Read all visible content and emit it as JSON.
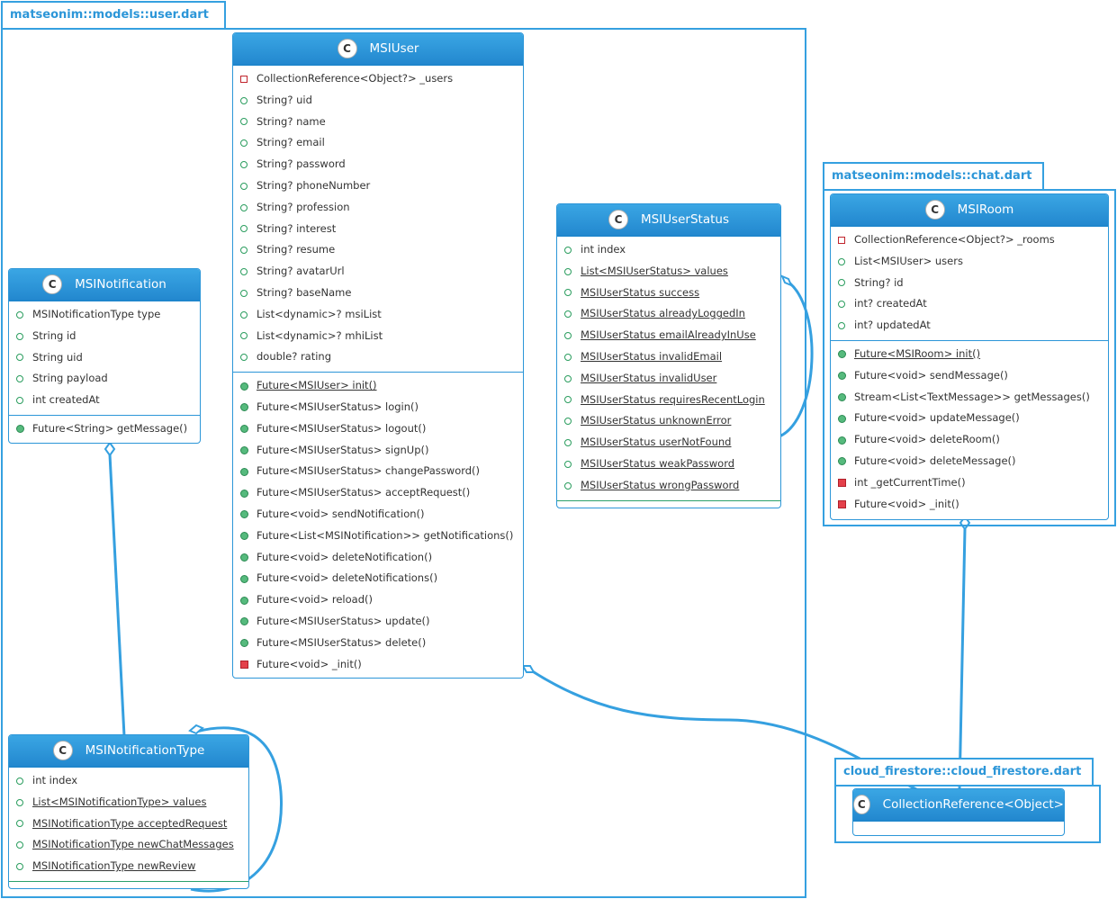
{
  "packages": {
    "user": "matseonim::models::user.dart",
    "chat": "matseonim::models::chat.dart",
    "firestore": "cloud_firestore::cloud_firestore.dart"
  },
  "stereotype": "C",
  "classes": {
    "msiuser": {
      "name": "MSIUser",
      "fields": [
        {
          "vis": "private",
          "text": "CollectionReference<Object?> _users"
        },
        {
          "vis": "public",
          "text": "String? uid"
        },
        {
          "vis": "public",
          "text": "String? name"
        },
        {
          "vis": "public",
          "text": "String? email"
        },
        {
          "vis": "public",
          "text": "String? password"
        },
        {
          "vis": "public",
          "text": "String? phoneNumber"
        },
        {
          "vis": "public",
          "text": "String? profession"
        },
        {
          "vis": "public",
          "text": "String? interest"
        },
        {
          "vis": "public",
          "text": "String? resume"
        },
        {
          "vis": "public",
          "text": "String? avatarUrl"
        },
        {
          "vis": "public",
          "text": "String? baseName"
        },
        {
          "vis": "public",
          "text": "List<dynamic>? msiList"
        },
        {
          "vis": "public",
          "text": "List<dynamic>? mhiList"
        },
        {
          "vis": "public",
          "text": "double? rating"
        }
      ],
      "methods": [
        {
          "vis": "public",
          "text": "Future<MSIUser> init()",
          "static": true
        },
        {
          "vis": "public",
          "text": "Future<MSIUserStatus> login()"
        },
        {
          "vis": "public",
          "text": "Future<MSIUserStatus> logout()"
        },
        {
          "vis": "public",
          "text": "Future<MSIUserStatus> signUp()"
        },
        {
          "vis": "public",
          "text": "Future<MSIUserStatus> changePassword()"
        },
        {
          "vis": "public",
          "text": "Future<MSIUserStatus> acceptRequest()"
        },
        {
          "vis": "public",
          "text": "Future<void> sendNotification()"
        },
        {
          "vis": "public",
          "text": "Future<List<MSINotification>> getNotifications()"
        },
        {
          "vis": "public",
          "text": "Future<void> deleteNotification()"
        },
        {
          "vis": "public",
          "text": "Future<void> deleteNotifications()"
        },
        {
          "vis": "public",
          "text": "Future<void> reload()"
        },
        {
          "vis": "public",
          "text": "Future<MSIUserStatus> update()"
        },
        {
          "vis": "public",
          "text": "Future<MSIUserStatus> delete()"
        },
        {
          "vis": "private",
          "text": "Future<void> _init()"
        }
      ]
    },
    "msiuserstatus": {
      "name": "MSIUserStatus",
      "fields": [
        {
          "vis": "public",
          "text": "int index"
        },
        {
          "vis": "public",
          "text": "List<MSIUserStatus> values",
          "static": true
        },
        {
          "vis": "public",
          "text": "MSIUserStatus success",
          "static": true
        },
        {
          "vis": "public",
          "text": "MSIUserStatus alreadyLoggedIn",
          "static": true
        },
        {
          "vis": "public",
          "text": "MSIUserStatus emailAlreadyInUse",
          "static": true
        },
        {
          "vis": "public",
          "text": "MSIUserStatus invalidEmail",
          "static": true
        },
        {
          "vis": "public",
          "text": "MSIUserStatus invalidUser",
          "static": true
        },
        {
          "vis": "public",
          "text": "MSIUserStatus requiresRecentLogin",
          "static": true
        },
        {
          "vis": "public",
          "text": "MSIUserStatus unknownError",
          "static": true
        },
        {
          "vis": "public",
          "text": "MSIUserStatus userNotFound",
          "static": true
        },
        {
          "vis": "public",
          "text": "MSIUserStatus weakPassword",
          "static": true
        },
        {
          "vis": "public",
          "text": "MSIUserStatus wrongPassword",
          "static": true
        }
      ],
      "methods": []
    },
    "msinotification": {
      "name": "MSINotification",
      "fields": [
        {
          "vis": "public",
          "text": "MSINotificationType type"
        },
        {
          "vis": "public",
          "text": "String id"
        },
        {
          "vis": "public",
          "text": "String uid"
        },
        {
          "vis": "public",
          "text": "String payload"
        },
        {
          "vis": "public",
          "text": "int createdAt"
        }
      ],
      "methods": [
        {
          "vis": "public",
          "text": "Future<String> getMessage()"
        }
      ]
    },
    "msinotificationtype": {
      "name": "MSINotificationType",
      "fields": [
        {
          "vis": "public",
          "text": "int index"
        },
        {
          "vis": "public",
          "text": "List<MSINotificationType> values",
          "static": true
        },
        {
          "vis": "public",
          "text": "MSINotificationType acceptedRequest",
          "static": true
        },
        {
          "vis": "public",
          "text": "MSINotificationType newChatMessages",
          "static": true
        },
        {
          "vis": "public",
          "text": "MSINotificationType newReview",
          "static": true
        }
      ],
      "methods": []
    },
    "msiroom": {
      "name": "MSIRoom",
      "fields": [
        {
          "vis": "private",
          "text": "CollectionReference<Object?> _rooms"
        },
        {
          "vis": "public",
          "text": "List<MSIUser> users"
        },
        {
          "vis": "public",
          "text": "String? id"
        },
        {
          "vis": "public",
          "text": "int? createdAt"
        },
        {
          "vis": "public",
          "text": "int? updatedAt"
        }
      ],
      "methods": [
        {
          "vis": "public",
          "text": "Future<MSIRoom> init()",
          "static": true
        },
        {
          "vis": "public",
          "text": "Future<void> sendMessage()"
        },
        {
          "vis": "public",
          "text": "Stream<List<TextMessage>> getMessages()"
        },
        {
          "vis": "public",
          "text": "Future<void> updateMessage()"
        },
        {
          "vis": "public",
          "text": "Future<void> deleteRoom()"
        },
        {
          "vis": "public",
          "text": "Future<void> deleteMessage()"
        },
        {
          "vis": "private",
          "text": "int _getCurrentTime()"
        },
        {
          "vis": "private",
          "text": "Future<void> _init()"
        }
      ]
    },
    "collectionreference": {
      "name": "CollectionReference<Object>",
      "fields": [],
      "methods": []
    }
  },
  "colors": {
    "accent": "#35a0e0",
    "header": "#2891d6",
    "public": "#56ba7d",
    "private": "#e4404a"
  }
}
